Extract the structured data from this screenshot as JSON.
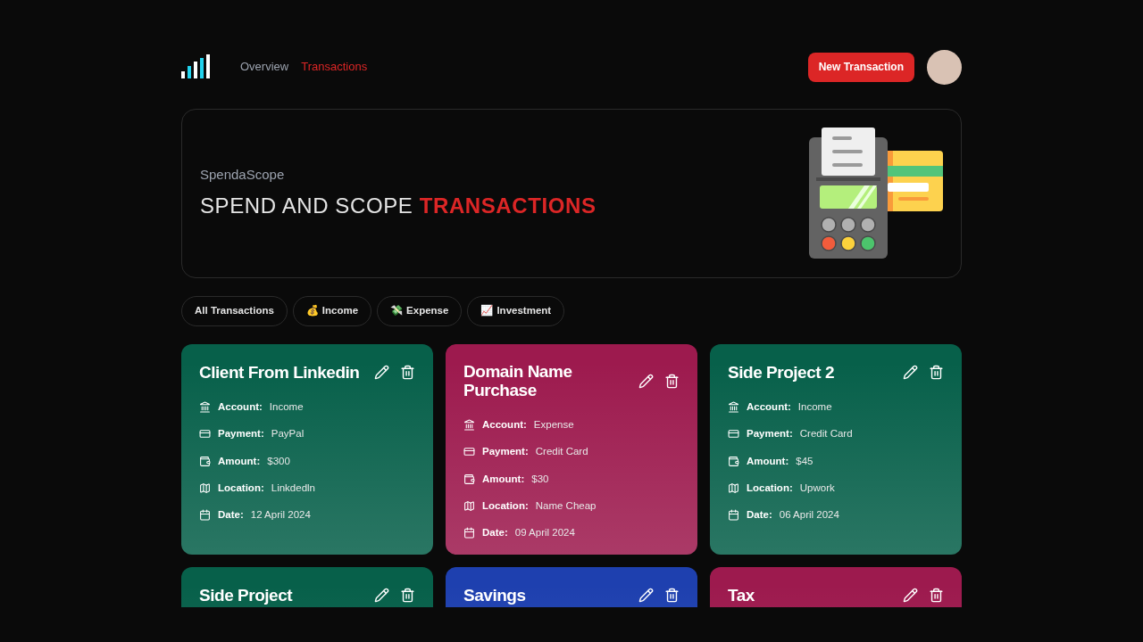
{
  "nav": {
    "links": [
      {
        "label": "Overview",
        "selected": false
      },
      {
        "label": "Transactions",
        "selected": true
      }
    ],
    "new_button": "New Transaction"
  },
  "hero": {
    "subtitle": "SpendaScope",
    "title_plain": "SPEND AND SCOPE",
    "title_accent": "TRANSACTIONS"
  },
  "filters": [
    {
      "label": "All Transactions"
    },
    {
      "emoji": "💰",
      "label": "Income"
    },
    {
      "emoji": "💸",
      "label": "Expense"
    },
    {
      "emoji": "📈",
      "label": "Investment"
    }
  ],
  "cards": [
    {
      "title": "Client From Linkedin",
      "color": "#07604a",
      "fields": [
        {
          "kind": "account",
          "label": "Account:",
          "value": "Income"
        },
        {
          "kind": "payment",
          "label": "Payment:",
          "value": "PayPal"
        },
        {
          "kind": "amount",
          "label": "Amount:",
          "value": "$300"
        },
        {
          "kind": "location",
          "label": "Location:",
          "value": "Linkdedln"
        },
        {
          "kind": "date",
          "label": "Date:",
          "value": "12 April 2024"
        }
      ]
    },
    {
      "title": "Domain Name Purchase",
      "color": "#9d1a4e",
      "fields": [
        {
          "kind": "account",
          "label": "Account:",
          "value": "Expense"
        },
        {
          "kind": "payment",
          "label": "Payment:",
          "value": "Credit Card"
        },
        {
          "kind": "amount",
          "label": "Amount:",
          "value": "$30"
        },
        {
          "kind": "location",
          "label": "Location:",
          "value": "Name Cheap"
        },
        {
          "kind": "date",
          "label": "Date:",
          "value": "09 April 2024"
        }
      ]
    },
    {
      "title": "Side Project 2",
      "color": "#07604a",
      "fields": [
        {
          "kind": "account",
          "label": "Account:",
          "value": "Income"
        },
        {
          "kind": "payment",
          "label": "Payment:",
          "value": "Credit Card"
        },
        {
          "kind": "amount",
          "label": "Amount:",
          "value": "$45"
        },
        {
          "kind": "location",
          "label": "Location:",
          "value": "Upwork"
        },
        {
          "kind": "date",
          "label": "Date:",
          "value": "06 April 2024"
        }
      ]
    },
    {
      "title": "Side Project",
      "color": "#07604a"
    },
    {
      "title": "Savings",
      "color": "#1e40af"
    },
    {
      "title": "Tax",
      "color": "#9d1a4e"
    }
  ]
}
